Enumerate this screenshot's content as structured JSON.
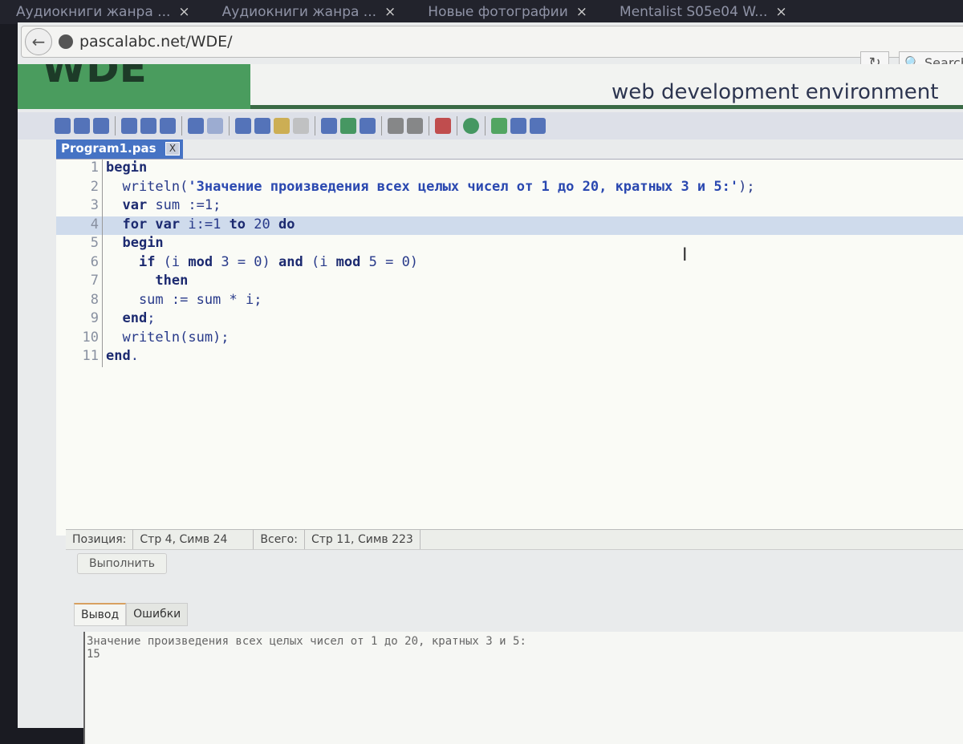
{
  "browser_tabs": [
    {
      "label": "Аудиокниги жанра ..."
    },
    {
      "label": "Аудиокниги жанра ..."
    },
    {
      "label": "Новые фотографии"
    },
    {
      "label": "Mentalist S05e04 W..."
    }
  ],
  "url": "pascalabc.net/WDE/",
  "search_placeholder": "Search",
  "banner": {
    "logo": "WDE",
    "slogan": "web development environment"
  },
  "file_tab": "Program1.pas",
  "code_lines": [
    [
      {
        "t": "kw",
        "v": "begin"
      }
    ],
    [
      {
        "t": "txt",
        "v": "  writeln("
      },
      {
        "t": "str",
        "v": "'Значение произведения всех целых чисел от 1 до 20, кратных 3 и 5:'"
      },
      {
        "t": "txt",
        "v": ");"
      }
    ],
    [
      {
        "t": "txt",
        "v": "  "
      },
      {
        "t": "kw",
        "v": "var"
      },
      {
        "t": "txt",
        "v": " sum :=1;"
      }
    ],
    [
      {
        "t": "txt",
        "v": "  "
      },
      {
        "t": "kw",
        "v": "for var"
      },
      {
        "t": "txt",
        "v": " i:=1 "
      },
      {
        "t": "kw",
        "v": "to"
      },
      {
        "t": "txt",
        "v": " 20 "
      },
      {
        "t": "kw",
        "v": "do"
      }
    ],
    [
      {
        "t": "txt",
        "v": "  "
      },
      {
        "t": "kw",
        "v": "begin"
      }
    ],
    [
      {
        "t": "txt",
        "v": "    "
      },
      {
        "t": "kw",
        "v": "if"
      },
      {
        "t": "txt",
        "v": " (i "
      },
      {
        "t": "kw",
        "v": "mod"
      },
      {
        "t": "txt",
        "v": " 3 = 0) "
      },
      {
        "t": "kw",
        "v": "and"
      },
      {
        "t": "txt",
        "v": " (i "
      },
      {
        "t": "kw",
        "v": "mod"
      },
      {
        "t": "txt",
        "v": " 5 = 0)"
      }
    ],
    [
      {
        "t": "txt",
        "v": "      "
      },
      {
        "t": "kw",
        "v": "then"
      }
    ],
    [
      {
        "t": "txt",
        "v": "    sum := sum * i;"
      }
    ],
    [
      {
        "t": "txt",
        "v": "  "
      },
      {
        "t": "kw",
        "v": "end"
      },
      {
        "t": "txt",
        "v": ";"
      }
    ],
    [
      {
        "t": "txt",
        "v": "  writeln(sum);"
      }
    ],
    [
      {
        "t": "kw",
        "v": "end"
      },
      {
        "t": "txt",
        "v": "."
      }
    ]
  ],
  "current_line": 4,
  "status": {
    "position_label": "Позиция:",
    "position_value": "Стр 4, Симв 24",
    "total_label": "Всего:",
    "total_value": "Стр 11, Симв 223"
  },
  "run_button": "Выполнить",
  "output_tabs": [
    {
      "label": "Вывод"
    },
    {
      "label": "Ошибки"
    }
  ],
  "output_text": "Значение произведения всех целых чисел от 1 до 20, кратных 3 и 5:\n15"
}
